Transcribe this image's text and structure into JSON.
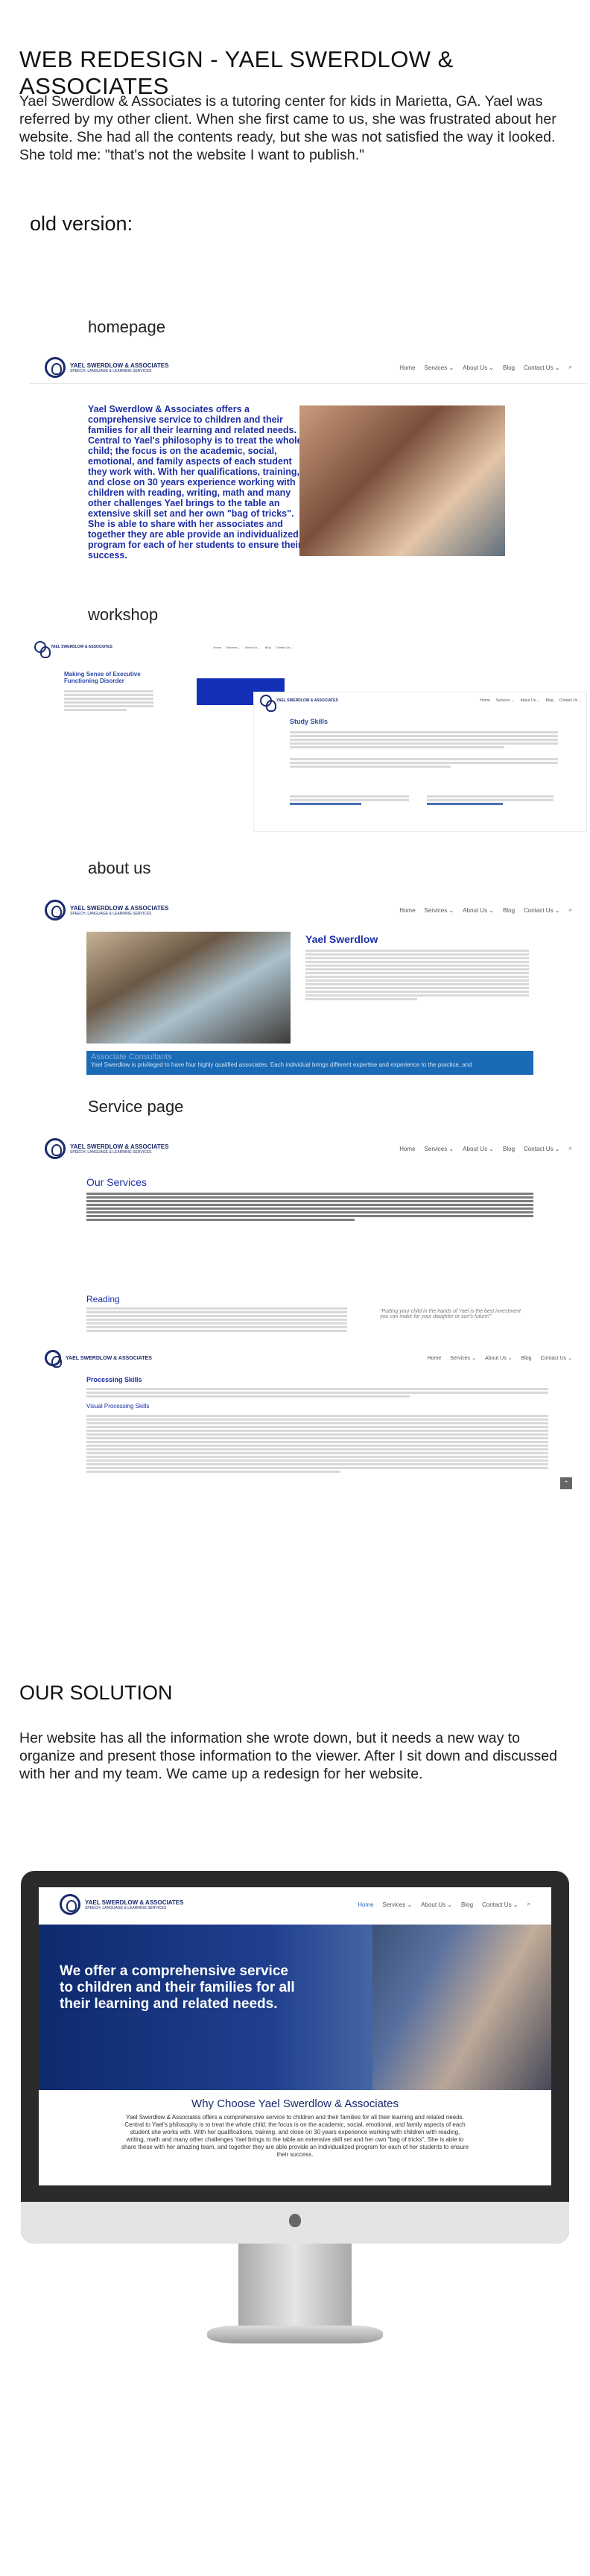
{
  "header": {
    "title": "WEB REDESIGN - YAEL SWERDLOW & ASSOCIATES",
    "intro": "Yael Swerdlow & Associates is a tutoring center for kids in Marietta, GA. Yael was referred by my other client. When she first came to us, she was frustrated about her website. She had all the contents ready, but she was not satisfied the way it looked. She told me: \"that's not the website I want to publish.\""
  },
  "old_version": {
    "heading": "old version:",
    "homepage_label": "homepage",
    "workshop_label": "workshop",
    "about_label": "about us",
    "service_label": "Service page"
  },
  "site": {
    "logo_name": "YAEL SWERDLOW & ASSOCIATES",
    "logo_tagline": "SPEECH, LANGUAGE & LEARNING SERVICES",
    "nav": [
      "Home",
      "Services ⌄",
      "About Us ⌄",
      "Blog",
      "Contact Us ⌄"
    ],
    "search_icon": "search-icon"
  },
  "homepage_shot": {
    "blurb": "Yael Swerdlow & Associates offers a comprehensive service to children and their families for all their learning and related needs. Central to Yael's philosophy is to treat the whole child; the focus is on the academic, social, emotional, and family aspects of each student they work with. With her qualifications, training, and close on 30 years experience working with children with reading, writing, math and many other challenges Yael brings to the table an extensive skill set and her own \"bag of tricks\". She is able to share with her associates and together they are able provide an individualized program for each of her students to ensure their success."
  },
  "workshop_shot": {
    "heading": "Making Sense of Executive Functioning Disorder",
    "side_heading": "Study Skills"
  },
  "about_shot": {
    "name": "Yael Swerdlow",
    "banner_title": "Associate Consultants",
    "banner_text": "Yael Swerdlow is privileged to have four highly qualified associates. Each individual brings different expertise and experience to the practice, and"
  },
  "service_shot": {
    "heading": "Our Services",
    "reading_heading": "Reading",
    "quote": "\"Putting your child in the hands of Yael is the best investment you can make for your daughter or son's future!\"",
    "processing_heading": "Processing Skills",
    "visual_heading": "Visual Processing Skills"
  },
  "solution": {
    "heading": "OUR SOLUTION",
    "text": "Her website has all the information she wrote down, but it needs a new way to organize and present those information to the viewer. After I sit down and discussed with her and my team. We came up a redesign for her website."
  },
  "redesign": {
    "hero_text": "We offer a comprehensive service to children and their families for all their learning and related needs.",
    "why_heading": "Why Choose Yael Swerdlow & Associates",
    "why_text": "Yael Swerdlow & Associates offers a comprehensive service to children and their families for all their learning and related needs. Central to Yael's philosophy is to treat the whole child; the focus is on the academic, social, emotional, and family aspects of each student she works with. With her qualifications, training, and close on 30 years experience working with children with reading, writing, math and many other challenges Yael brings to the table an extensive skill set and her own \"bag of tricks\". She is able to share these with her amazing team, and together they are able provide an individualized program for each of her students to ensure their success."
  },
  "colors": {
    "brand_navy": "#1b2a6b",
    "link_blue": "#2a66c4",
    "hero_blue": "#1f3f8e"
  }
}
